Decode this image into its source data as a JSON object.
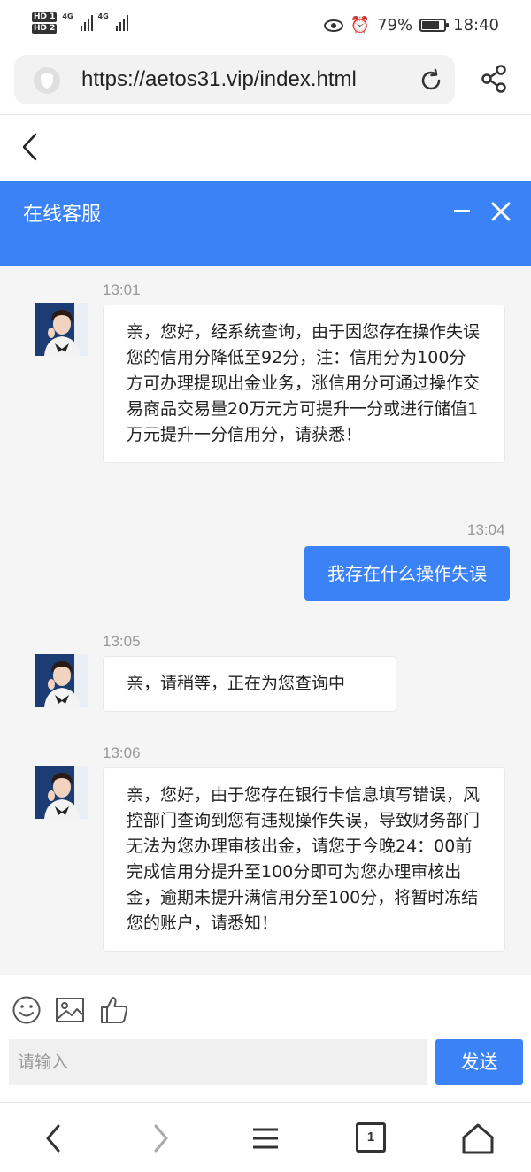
{
  "status_bar": {
    "sim1": "HD 1",
    "sim2": "HD 2",
    "network1": "4G",
    "network2": "4G",
    "battery_percent": "79%",
    "battery_level": 0.79,
    "time": "18:40"
  },
  "browser": {
    "url": "https://aetos31.vip/index.html",
    "tab_count": "1"
  },
  "chat": {
    "title": "在线客服",
    "messages": [
      {
        "time": "13:01",
        "from": "agent",
        "text": "亲，您好，经系统查询，由于因您存在操作失误您的信用分降低至92分，注：信用分为100分方可办理提现出金业务，涨信用分可通过操作交易商品交易量20万元方可提升一分或进行储值1万元提升一分信用分，请获悉！"
      },
      {
        "time": "13:04",
        "from": "user",
        "text": "我存在什么操作失误"
      },
      {
        "time": "13:05",
        "from": "agent",
        "text": "亲，请稍等，正在为您查询中"
      },
      {
        "time": "13:06",
        "from": "agent",
        "text": "亲，您好，由于您存在银行卡信息填写错误，风控部门查询到您有违规操作失误，导致财务部门无法为您办理审核出金，请您于今晚24：00前完成信用分提升至100分即可为您办理审核出金，逾期未提升满信用分至100分，将暂时冻结您的账户，请悉知！"
      }
    ],
    "input_placeholder": "请输入",
    "send_label": "发送"
  },
  "colors": {
    "accent": "#3b82f6",
    "background": "#f5f5f5"
  },
  "icons": [
    "shield-icon",
    "refresh-icon",
    "share-icon",
    "back-chevron-icon",
    "minimize-icon",
    "close-icon",
    "emoji-icon",
    "image-icon",
    "thumbs-up-icon",
    "nav-back-icon",
    "nav-forward-icon",
    "menu-icon",
    "tabs-icon",
    "home-icon"
  ]
}
